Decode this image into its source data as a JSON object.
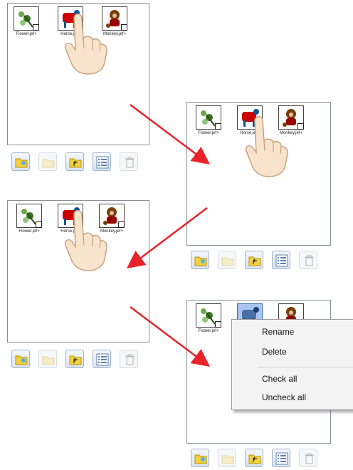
{
  "files": [
    {
      "name": "Flower.jef+",
      "icon": "flower-embroidery-icon"
    },
    {
      "name": "Horse.jef+",
      "icon": "horse-embroidery-icon"
    },
    {
      "name": "Monkey.jef+",
      "icon": "monkey-embroidery-icon"
    }
  ],
  "toolbar": {
    "buttons": [
      "folder-open-icon",
      "folder-disabled-icon",
      "folder-up-icon",
      "list-view-icon",
      "trash-icon"
    ]
  },
  "context_menu": {
    "items": [
      {
        "label": "Rename"
      },
      {
        "label": "Delete"
      },
      {
        "label": "Check all"
      },
      {
        "label": "Uncheck all"
      }
    ]
  },
  "colors": {
    "arrow": "#e8242a",
    "selection": "#a9c6ee",
    "folder": "#f4d03f"
  }
}
